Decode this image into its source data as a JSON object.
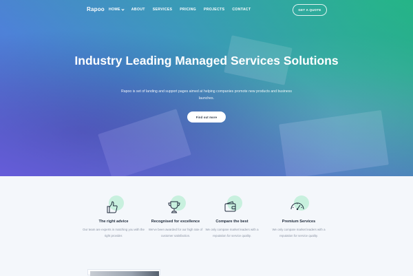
{
  "nav": {
    "logo": "Rapoo",
    "items": [
      {
        "label": "HOME",
        "has_dropdown": true
      },
      {
        "label": "ABOUT",
        "has_dropdown": false
      },
      {
        "label": "SERVICES",
        "has_dropdown": false
      },
      {
        "label": "PRICING",
        "has_dropdown": false
      },
      {
        "label": "PROJECTS",
        "has_dropdown": false
      },
      {
        "label": "CONTACT",
        "has_dropdown": false
      }
    ],
    "cta_label": "GET A QUOTE"
  },
  "hero": {
    "title": "Industry Leading Managed Services Solutions",
    "subtitle": "Rapoo is set of landing and support pages aimed at helping companies promote new products and business launches.",
    "button_label": "Find out more"
  },
  "features": [
    {
      "icon": "thumbs-up-icon",
      "title": "The right advice",
      "description": "Our team are experts in matching you with the right provider."
    },
    {
      "icon": "trophy-icon",
      "title": "Recognised for excellence",
      "description": "We've been awarded for our high rate of customer satisfaction."
    },
    {
      "icon": "wallet-icon",
      "title": "Compare the best",
      "description": "We only compare market leaders with a reputation for service quality."
    },
    {
      "icon": "speedometer-icon",
      "title": "Premium Services",
      "description": "We only compare market leaders with a reputation for service quality."
    }
  ],
  "colors": {
    "gradient_start": "#4f88d9",
    "gradient_end": "#1fb87a",
    "accent_circle": "#c8f0de",
    "heading": "#1e2a3b",
    "body_text": "#8a93a3"
  }
}
